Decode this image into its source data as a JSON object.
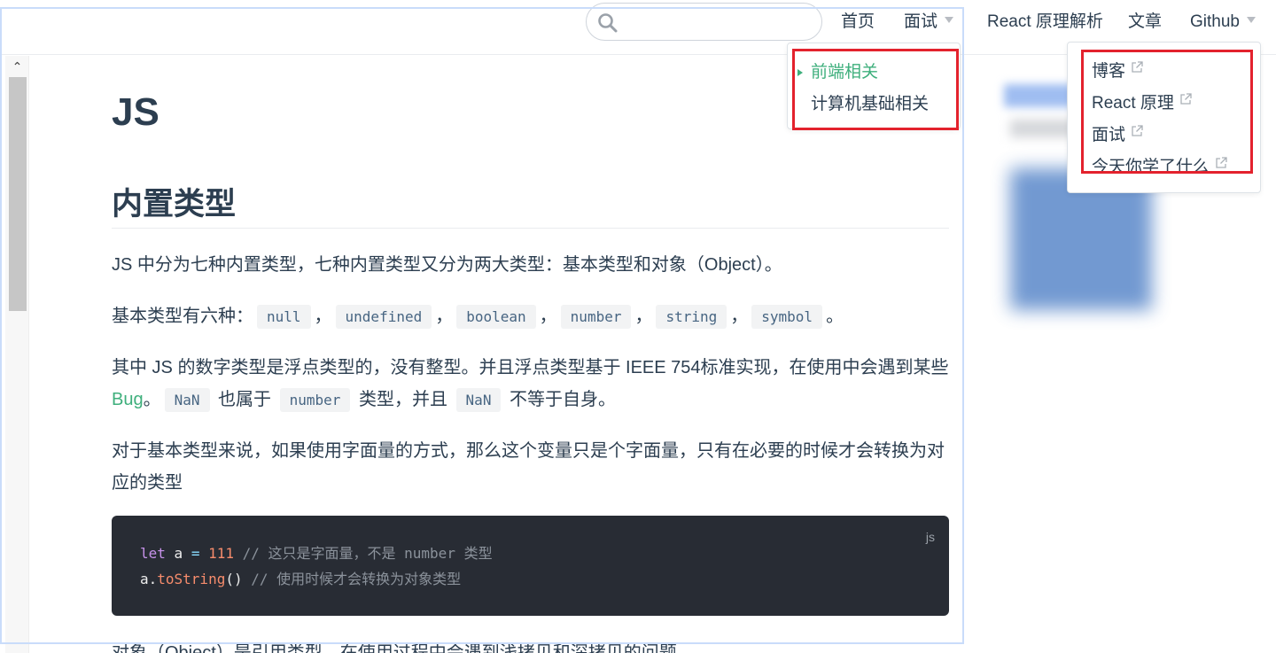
{
  "nav": {
    "search_placeholder": "",
    "home": "首页",
    "interview": "面试",
    "react": "React 原理解析",
    "articles": "文章",
    "github": "Github"
  },
  "interview_menu": {
    "items": [
      {
        "label": "前端相关",
        "active": true
      },
      {
        "label": "计算机基础相关",
        "active": false
      }
    ]
  },
  "github_menu": {
    "items": [
      {
        "label": "博客"
      },
      {
        "label": "React 原理"
      },
      {
        "label": "面试"
      },
      {
        "label": "今天你学了什么"
      }
    ]
  },
  "article": {
    "title": "JS",
    "section_title": "内置类型",
    "p1": "JS 中分为七种内置类型，七种内置类型又分为两大类型：基本类型和对象（Object）。",
    "p2_prefix": "基本类型有六种：",
    "p2_types": [
      "null",
      "undefined",
      "boolean",
      "number",
      "string",
      "symbol"
    ],
    "p2_sep": "，",
    "p2_end": "。",
    "p3_text1": "其中 JS 的数字类型是浮点类型的，没有整型。并且浮点类型基于 IEEE 754标准实现，在使用中会遇到某些 ",
    "p3_link": "Bug",
    "p3_text2": "。",
    "p3_code1": "NaN",
    "p3_text3": " 也属于 ",
    "p3_code2": "number",
    "p3_text4": " 类型，并且 ",
    "p3_code3": "NaN",
    "p3_text5": " 不等于自身。",
    "p4": "对于基本类型来说，如果使用字面量的方式，那么这个变量只是个字面量，只有在必要的时候才会转换为对应的类型",
    "code": {
      "lang": "js",
      "l1_kw": "let",
      "l1_var": " a ",
      "l1_op": "=",
      "l1_num": " 111",
      "l1_comment": " // 这只是字面量，不是 number 类型",
      "l2_obj": "a.",
      "l2_fn": "toString",
      "l2_paren": "()",
      "l2_comment": " // 使用时候才会转换为对象类型"
    },
    "p5": "对象（Object）是引用类型，在使用过程中会遇到浅拷贝和深拷贝的问题。"
  },
  "colors": {
    "accent": "#3eaf7c",
    "text": "#2c3e50",
    "highlight_box": "#e3222d",
    "code_bg": "#282c34"
  }
}
